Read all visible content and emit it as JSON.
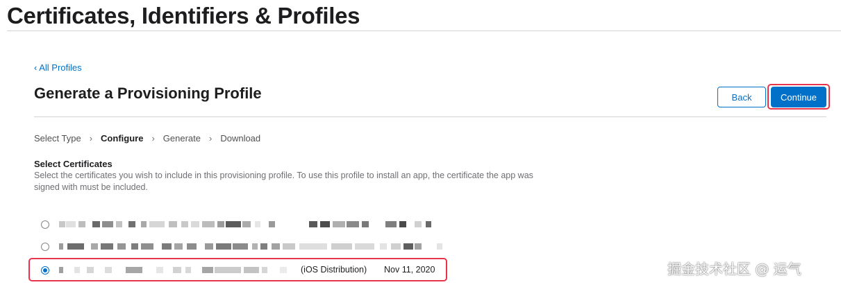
{
  "header": {
    "title": "Certificates, Identifiers & Profiles"
  },
  "nav": {
    "back_link": "‹ All Profiles"
  },
  "section": {
    "title": "Generate a Provisioning Profile"
  },
  "buttons": {
    "back_label": "Back",
    "continue_label": "Continue"
  },
  "steps": [
    "Select Type",
    "Configure",
    "Generate",
    "Download"
  ],
  "active_step": "Configure",
  "certificates": {
    "heading": "Select Certificates",
    "description": "Select the certificates you wish to include in this provisioning profile. To use this profile to install an app, the certificate the app was signed with must be included.",
    "items": [
      {
        "label": "",
        "date": "",
        "selected": false,
        "obscured": true
      },
      {
        "label": "",
        "date": "",
        "selected": false,
        "obscured": true
      },
      {
        "label": "(iOS Distribution)",
        "date": "Nov 11, 2020",
        "selected": true,
        "obscured": true
      }
    ]
  },
  "watermark": "掘金技术社区 @ 运气",
  "colors": {
    "accent": "#0070c9",
    "highlight": "#e8334a",
    "text": "#1d1d1f",
    "muted": "#6e6e73"
  }
}
